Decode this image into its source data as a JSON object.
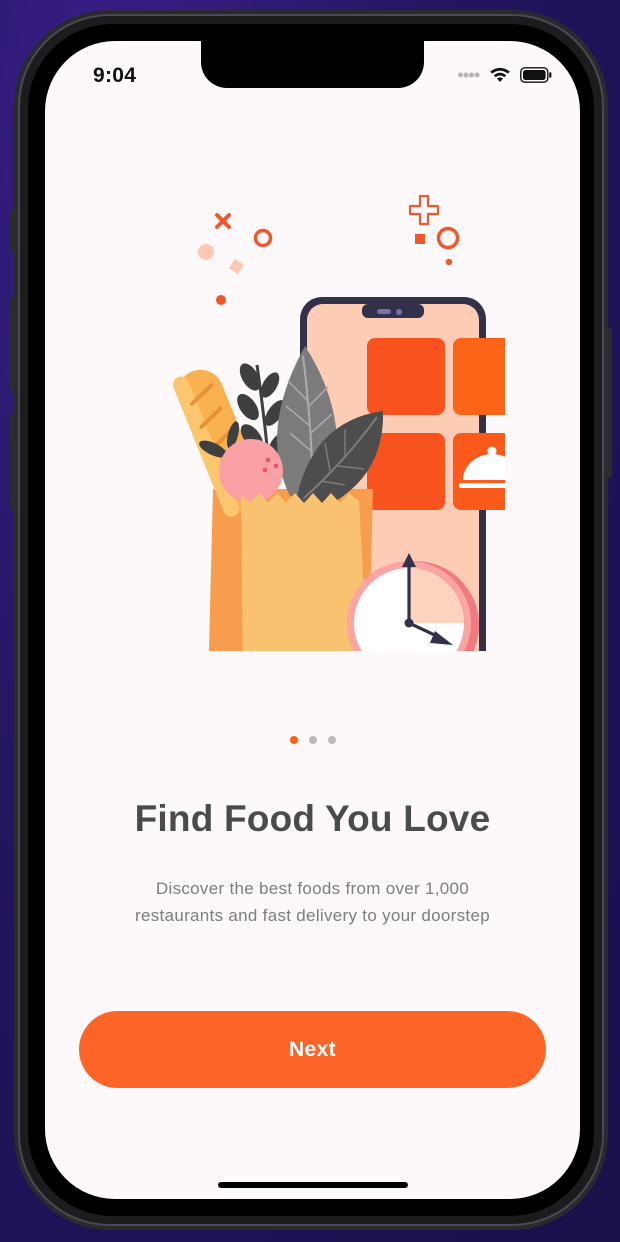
{
  "status_bar": {
    "time": "9:04",
    "icons": [
      "signal-dots-icon",
      "wifi-icon",
      "battery-icon"
    ]
  },
  "onboarding": {
    "illustration": "food-delivery-phone-illustration",
    "page_indicator": {
      "total": 3,
      "active_index": 0
    },
    "title": "Find Food You Love",
    "description_line1": "Discover the best foods from over 1,000",
    "description_line2": "restaurants and fast delivery to your doorstep",
    "next_label": "Next"
  },
  "colors": {
    "accent": "#fc6011",
    "title": "#4a4b4d",
    "body": "#7c7d7e",
    "background": "#fdf9fb"
  }
}
